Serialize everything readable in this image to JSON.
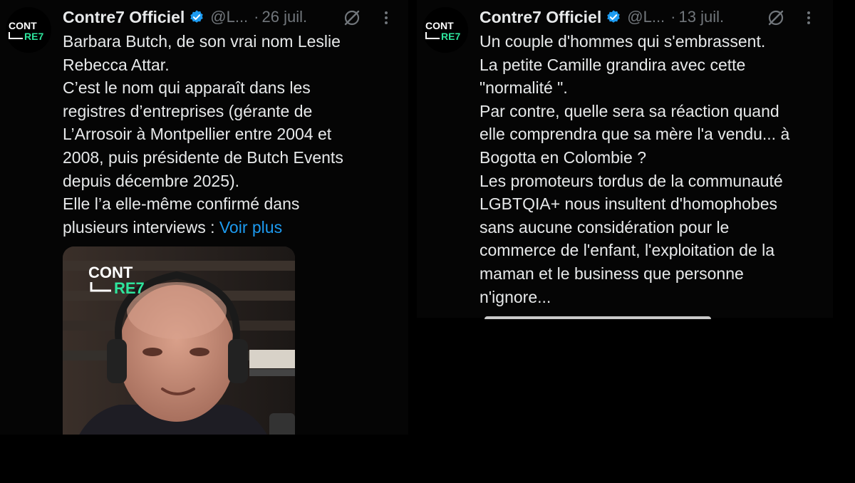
{
  "left_tweet": {
    "author_name": "Contre7 Officiel",
    "handle": "@L...",
    "separator": "·",
    "date": "26 juil.",
    "avatar_logo_text": [
      "CONT",
      "RE7"
    ],
    "lines": [
      "Barbara Butch, de son vrai nom Leslie",
      "Rebecca Attar.",
      "C’est le nom qui apparaît dans les",
      "registres d’entreprises (gérante de",
      "L’Arrosoir à Montpellier entre 2004 et",
      "2008, puis présidente de Butch Events",
      "depuis décembre 2025).",
      "Elle l’a elle-même confirmé dans"
    ],
    "last_line": "plusieurs interviews : ",
    "show_more": "Voir plus",
    "media_logo_text": [
      "CONT",
      "RE7"
    ]
  },
  "right_tweet": {
    "author_name": "Contre7 Officiel",
    "handle": "@L...",
    "separator": "·",
    "date": "13 juil.",
    "avatar_logo_text": [
      "CONT",
      "RE7"
    ],
    "lines": [
      "Un couple d'hommes qui s'embrassent.",
      "La petite Camille grandira avec cette",
      "\"normalité \".",
      "Par contre, quelle sera sa réaction quand",
      "elle comprendra que sa mère l'a vendu... à",
      "Bogotta en Colombie ?",
      "Les promoteurs tordus de la communauté",
      "LGBTQIA+ nous insultent d'homophobes",
      "sans aucune considération pour le",
      "commerce de l'enfant, l'exploitation de la",
      "maman et le business que personne",
      "n'ignore..."
    ]
  },
  "icons": {
    "verified": "verified-badge-icon",
    "grok": "grok-icon",
    "more": "more-options-icon"
  },
  "colors": {
    "background": "#000000",
    "text": "#e7e9ea",
    "secondary": "#71767b",
    "link": "#1d9bf0",
    "verified": "#1d9bf0",
    "brand_green": "#2ee59d"
  }
}
